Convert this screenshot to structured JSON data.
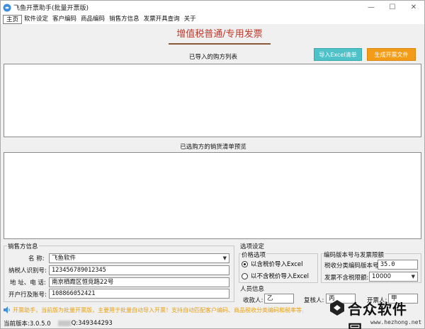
{
  "window": {
    "title": "飞鱼开票助手(批量开票版)",
    "controls": [
      "—",
      "☐",
      "✕"
    ]
  },
  "menu": {
    "items": [
      "主页",
      "软件设定",
      "客户编码",
      "商品编码",
      "销售方信息",
      "发票开具查询",
      "关于"
    ]
  },
  "header": {
    "title": "增值税普通/专用发票"
  },
  "buttons": {
    "import_excel": "导入Excel清单",
    "generate_file": "生成开票文件"
  },
  "sections": {
    "imported_buyers": "已导入的购方列表",
    "goods_preview": "已选购方的销货清单预览"
  },
  "seller": {
    "group_title": "销售方信息",
    "name_label": "名  称:",
    "name_value": "飞鱼软件",
    "tax_id_label": "纳税人识别号:",
    "tax_id_value": "123456789012345",
    "address_label": "地 址、电 话:",
    "address_value": "南京栖霞区恒竞路22号",
    "bank_label": "开户行及账号:",
    "bank_value": "108866052421"
  },
  "options": {
    "group_title": "选项设定",
    "price_group_title": "价格选项",
    "price_with_tax": "以含税价导入Excel",
    "price_without_tax": "以不含税价导入Excel",
    "price_selected": "with_tax",
    "code_group_title": "编码版本号与发票限额",
    "code_version_label": "税收分类编码版本号:",
    "code_version_value": "35.0",
    "limit_label": "发票不含税限额:",
    "limit_value": "10000",
    "people_group_title": "人员信息",
    "payee_label": "收款人:",
    "payee_value": "乙",
    "reviewer_label": "复核人:",
    "reviewer_value": "丙",
    "drawer_label": "开票人:",
    "drawer_value": "甲"
  },
  "marquee": {
    "text": "开票助手，当前版为批量开票版，主要用于批量自动导入开票！支持自动匹配客户编码、商品税收分类编码和税率等，更多操作请微信扫码"
  },
  "status": {
    "version": "当前版本:3.0.5.0",
    "qq": "Q:349344293"
  },
  "watermark": {
    "name": "合众软件园",
    "url": "www.hezhong.net"
  },
  "colors": {
    "title_red": "#c0392b",
    "import_btn": "#4ec2c8",
    "generate_btn": "#f39c1a",
    "marquee_text": "#e8a010"
  }
}
